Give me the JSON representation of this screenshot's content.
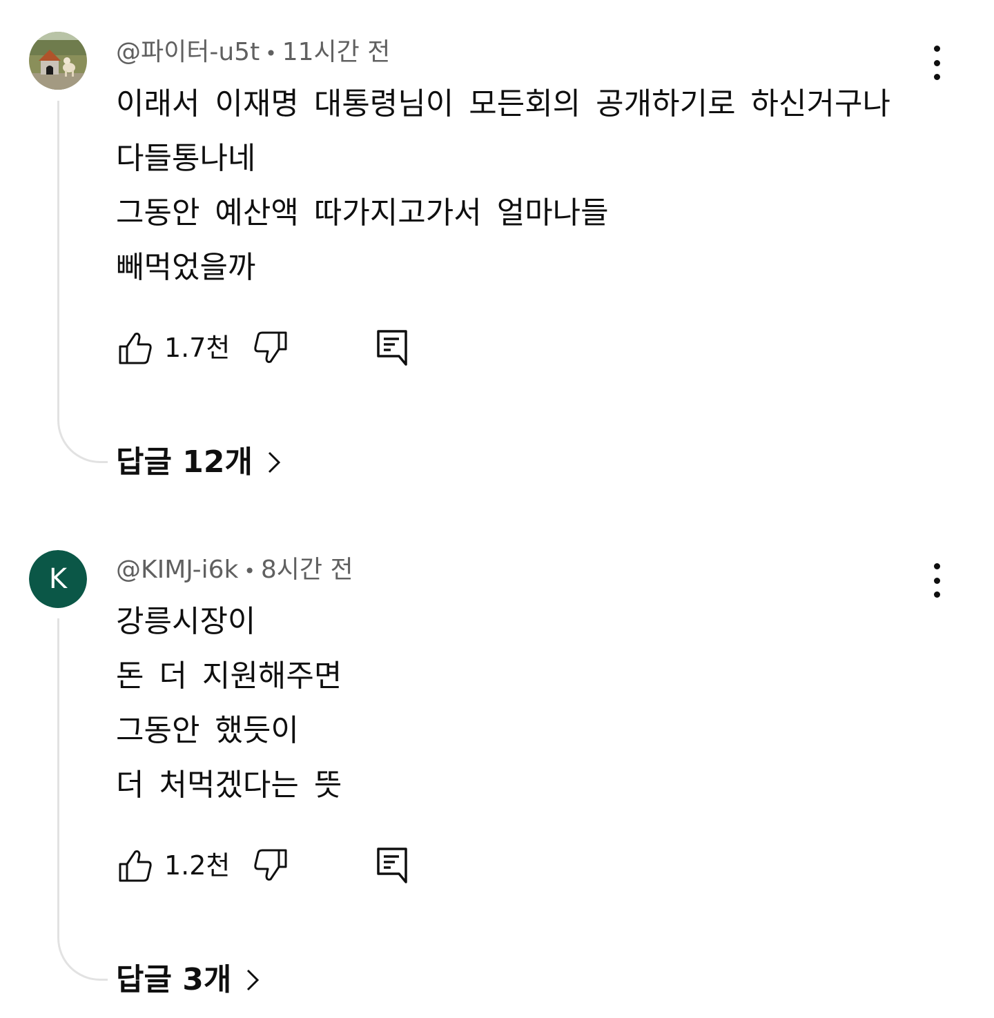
{
  "comments": [
    {
      "author": "@파이터-u5t",
      "separator": "•",
      "time": "11시간 전",
      "avatar_icon": "dog-house-photo",
      "lines": [
        "이래서 이재명 대통령님이 모든회의 공개하기로 하신거구나",
        "다들통나네",
        "그동안 예산액 따가지고가서 얼마나들",
        "빼먹었을까"
      ],
      "likes": "1.7천",
      "replies_label": "답글 12개"
    },
    {
      "author": "@KIMJ-i6k",
      "separator": "•",
      "time": "8시간 전",
      "avatar_letter": "K",
      "avatar_color": "#0b5747",
      "lines": [
        "강릉시장이",
        "돈 더 지원해주면",
        "그동안 했듯이",
        "더 처먹겠다는 뜻"
      ],
      "likes": "1.2천",
      "replies_label": "답글 3개"
    }
  ],
  "icons": {
    "like": "thumbs-up-icon",
    "dislike": "thumbs-down-icon",
    "reply": "comment-icon",
    "menu": "more-vert-icon",
    "chevron": "chevron-right-icon"
  }
}
